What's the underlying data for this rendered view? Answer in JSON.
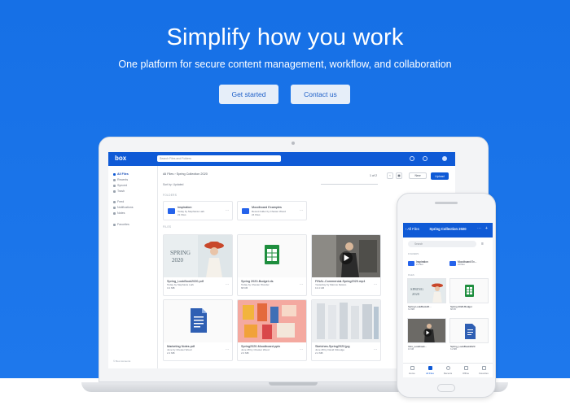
{
  "hero": {
    "headline": "Simplify how you work",
    "subline": "One platform for secure content management, workflow, and collaboration",
    "primary_cta": "Get started",
    "secondary_cta": "Contact us",
    "background_color": "#1a73e8"
  },
  "laptop_app": {
    "logo": "box",
    "search_placeholder": "Search Files and Folders",
    "sidebar": [
      {
        "label": "All Files",
        "active": true
      },
      {
        "label": "Recents",
        "active": false
      },
      {
        "label": "Synced",
        "active": false
      },
      {
        "label": "Trash",
        "active": false
      },
      {
        "label": "Feed",
        "active": false
      },
      {
        "label": "Notifications",
        "active": false
      },
      {
        "label": "Notes",
        "active": false
      },
      {
        "label": "Favorites",
        "active": false
      }
    ],
    "sidebar_footer": "© Box Accounts",
    "breadcrumb": "All Files  ›  Spring Collection 2020",
    "sort_label": "Sort by: Updated",
    "pager": "1 of 2",
    "new_button": "New",
    "upload_button": "Upload",
    "folders_label": "FOLDERS",
    "files_label": "FILES",
    "folders": [
      {
        "name": "Inspiration",
        "owner": "Today by Stephanie Lark",
        "meta": "21 Files"
      },
      {
        "name": "Moodboard Examples",
        "owner": "Recent folder by Chester Wood",
        "meta": "24 Files"
      }
    ],
    "files": [
      {
        "name": "Spring_LookBook2020.pdf",
        "owner": "Today by Stephanie Lark",
        "size": "3.2 MB",
        "thumb": "spring"
      },
      {
        "name": "Spring 2020-Budget.xls",
        "owner": "Today by Chester Wonder",
        "size": "68 KB",
        "thumb": "sheet"
      },
      {
        "name": "FINAL-Commercial-Spring2020.mp4",
        "owner": "Yesterday by Marcus Delano",
        "size": "13.4 GB",
        "thumb": "video"
      },
      {
        "name": "Marketing Notes.pdf",
        "owner": "June by Chester Wood",
        "size": "2.2 MB",
        "thumb": "doc"
      },
      {
        "name": "Spring2020-Moodboard.pptx",
        "owner": "June 28 by Chester Wood",
        "size": "2.0 MB",
        "thumb": "mood"
      },
      {
        "name": "Sketches-Spring2020.jpg",
        "owner": "June 28 by David Kittredge",
        "size": "2.4 MB",
        "thumb": "sketch"
      }
    ]
  },
  "phone_app": {
    "back_label": "‹ All Files",
    "title": "Spring Collection 2020",
    "search_placeholder": "Search",
    "folders_label": "FOLDERS",
    "files_label": "FILES",
    "folders": [
      {
        "name": "Inspiration",
        "meta": "21 Files"
      },
      {
        "name": "Moodboard Ex...",
        "meta": "24 Files"
      }
    ],
    "files": [
      {
        "name": "Spring LookBook20...",
        "meta": "3.2 MB",
        "thumb": "spring"
      },
      {
        "name": "Spring 2020-Budget",
        "meta": "68 KB",
        "thumb": "sheet"
      },
      {
        "name": "Intro_Lookbook...",
        "meta": "13 GB",
        "thumb": "video"
      },
      {
        "name": "Spring_LookBook2020",
        "meta": "3.2 MB",
        "thumb": "doc"
      }
    ],
    "tabs": [
      {
        "label": "Home",
        "active": false
      },
      {
        "label": "All Files",
        "active": true
      },
      {
        "label": "Recents",
        "active": false
      },
      {
        "label": "Offline",
        "active": false
      },
      {
        "label": "Favorites",
        "active": false
      }
    ]
  }
}
